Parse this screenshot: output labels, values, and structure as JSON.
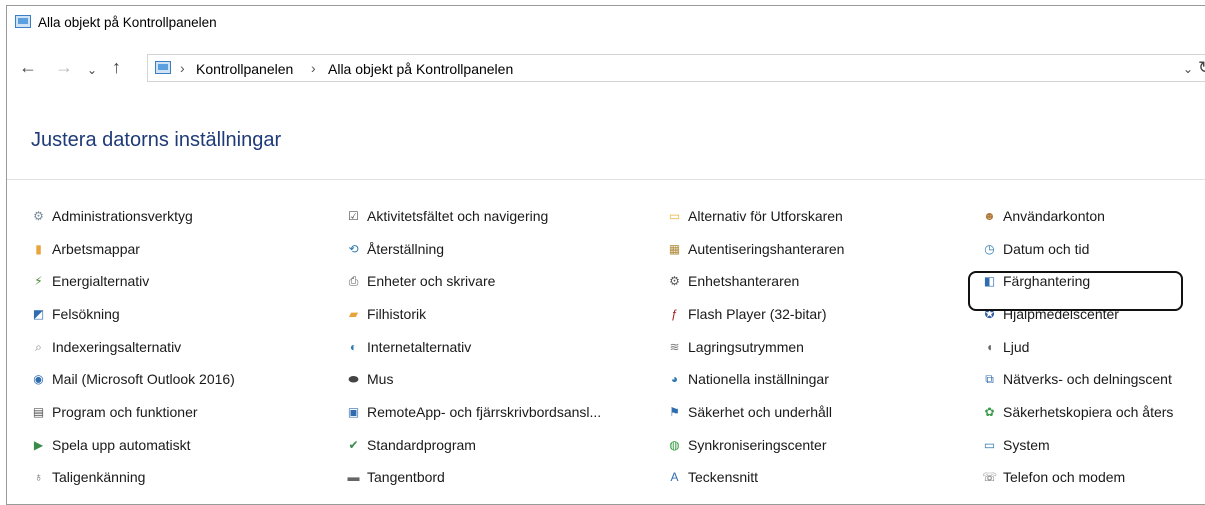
{
  "window": {
    "title": "Alla objekt på Kontrollpanelen"
  },
  "nav": {
    "back_icon": "←",
    "forward_icon": "→",
    "history_icon": "⌄",
    "up_icon": "↑",
    "breadcrumb": [
      "Kontrollpanelen",
      "Alla objekt på Kontrollpanelen"
    ],
    "separator": "›",
    "dropdown_icon": "⌄",
    "refresh_icon": "↻"
  },
  "heading": "Justera datorns inställningar",
  "columns": [
    [
      {
        "label": "Administrationsverktyg",
        "icon": "admin-tools-icon",
        "glyph": "⚙",
        "color": "#7a8a9a"
      },
      {
        "label": "Arbetsmappar",
        "icon": "work-folders-icon",
        "glyph": "▮",
        "color": "#e8a33a"
      },
      {
        "label": "Energialternativ",
        "icon": "power-options-icon",
        "glyph": "⚡",
        "color": "#4a8a3a"
      },
      {
        "label": "Felsökning",
        "icon": "troubleshooting-icon",
        "glyph": "◩",
        "color": "#2f6db0"
      },
      {
        "label": "Indexeringsalternativ",
        "icon": "indexing-icon",
        "glyph": "⌕",
        "color": "#8a8a8a"
      },
      {
        "label": "Mail (Microsoft Outlook 2016)",
        "icon": "mail-icon",
        "glyph": "◉",
        "color": "#2f6db0"
      },
      {
        "label": "Program och funktioner",
        "icon": "programs-icon",
        "glyph": "▤",
        "color": "#555"
      },
      {
        "label": "Spela upp automatiskt",
        "icon": "autoplay-icon",
        "glyph": "▶",
        "color": "#3a8a4a"
      },
      {
        "label": "Taligenkänning",
        "icon": "speech-icon",
        "glyph": "♁",
        "color": "#666"
      }
    ],
    [
      {
        "label": "Aktivitetsfältet och navigering",
        "icon": "taskbar-icon",
        "glyph": "☑",
        "color": "#555"
      },
      {
        "label": "Återställning",
        "icon": "recovery-icon",
        "glyph": "⟲",
        "color": "#2f7ab0"
      },
      {
        "label": "Enheter och skrivare",
        "icon": "devices-printers-icon",
        "glyph": "⎙",
        "color": "#555"
      },
      {
        "label": "Filhistorik",
        "icon": "file-history-icon",
        "glyph": "▰",
        "color": "#e8a33a"
      },
      {
        "label": "Internetalternativ",
        "icon": "internet-options-icon",
        "glyph": "◐",
        "color": "#2f7ab0"
      },
      {
        "label": "Mus",
        "icon": "mouse-icon",
        "glyph": "⬬",
        "color": "#444"
      },
      {
        "label": "RemoteApp- och fjärrskrivbordsansl...",
        "icon": "remoteapp-icon",
        "glyph": "▣",
        "color": "#2f6db0"
      },
      {
        "label": "Standardprogram",
        "icon": "default-programs-icon",
        "glyph": "✔",
        "color": "#3a8a4a"
      },
      {
        "label": "Tangentbord",
        "icon": "keyboard-icon",
        "glyph": "▬",
        "color": "#666"
      }
    ],
    [
      {
        "label": "Alternativ för Utforskaren",
        "icon": "explorer-options-icon",
        "glyph": "▭",
        "color": "#e8b33a"
      },
      {
        "label": "Autentiseringshanteraren",
        "icon": "credential-manager-icon",
        "glyph": "▦",
        "color": "#b08a3a"
      },
      {
        "label": "Enhetshanteraren",
        "icon": "device-manager-icon",
        "glyph": "⚙",
        "color": "#555"
      },
      {
        "label": "Flash Player (32-bitar)",
        "icon": "flash-player-icon",
        "glyph": "ƒ",
        "color": "#a02020"
      },
      {
        "label": "Lagringsutrymmen",
        "icon": "storage-spaces-icon",
        "glyph": "≋",
        "color": "#777"
      },
      {
        "label": "Nationella inställningar",
        "icon": "region-icon",
        "glyph": "◕",
        "color": "#2f7ab0"
      },
      {
        "label": "Säkerhet och underhåll",
        "icon": "security-maintenance-icon",
        "glyph": "⚑",
        "color": "#2f6db0"
      },
      {
        "label": "Synkroniseringscenter",
        "icon": "sync-center-icon",
        "glyph": "◍",
        "color": "#2e9a3a"
      },
      {
        "label": "Teckensnitt",
        "icon": "fonts-icon",
        "glyph": "A",
        "color": "#2f6db0"
      }
    ],
    [
      {
        "label": "Användarkonton",
        "icon": "user-accounts-icon",
        "glyph": "☻",
        "color": "#b0783a"
      },
      {
        "label": "Datum och tid",
        "icon": "date-time-icon",
        "glyph": "◷",
        "color": "#2f7ab0"
      },
      {
        "label": "Färghantering",
        "icon": "color-management-icon",
        "glyph": "◧",
        "color": "#2f6db0"
      },
      {
        "label": "Hjälpmedelscenter",
        "icon": "ease-of-access-icon",
        "glyph": "✪",
        "color": "#2f5da0"
      },
      {
        "label": "Ljud",
        "icon": "sound-icon",
        "glyph": "◖",
        "color": "#666"
      },
      {
        "label": "Nätverks- och delningscent",
        "icon": "network-sharing-icon",
        "glyph": "⧉",
        "color": "#2f6db0"
      },
      {
        "label": "Säkerhetskopiera och åters",
        "icon": "backup-restore-icon",
        "glyph": "✿",
        "color": "#3a9a4a"
      },
      {
        "label": "System",
        "icon": "system-icon",
        "glyph": "▭",
        "color": "#2f7ab0"
      },
      {
        "label": "Telefon och modem",
        "icon": "phone-modem-icon",
        "glyph": "☏",
        "color": "#666"
      }
    ]
  ]
}
